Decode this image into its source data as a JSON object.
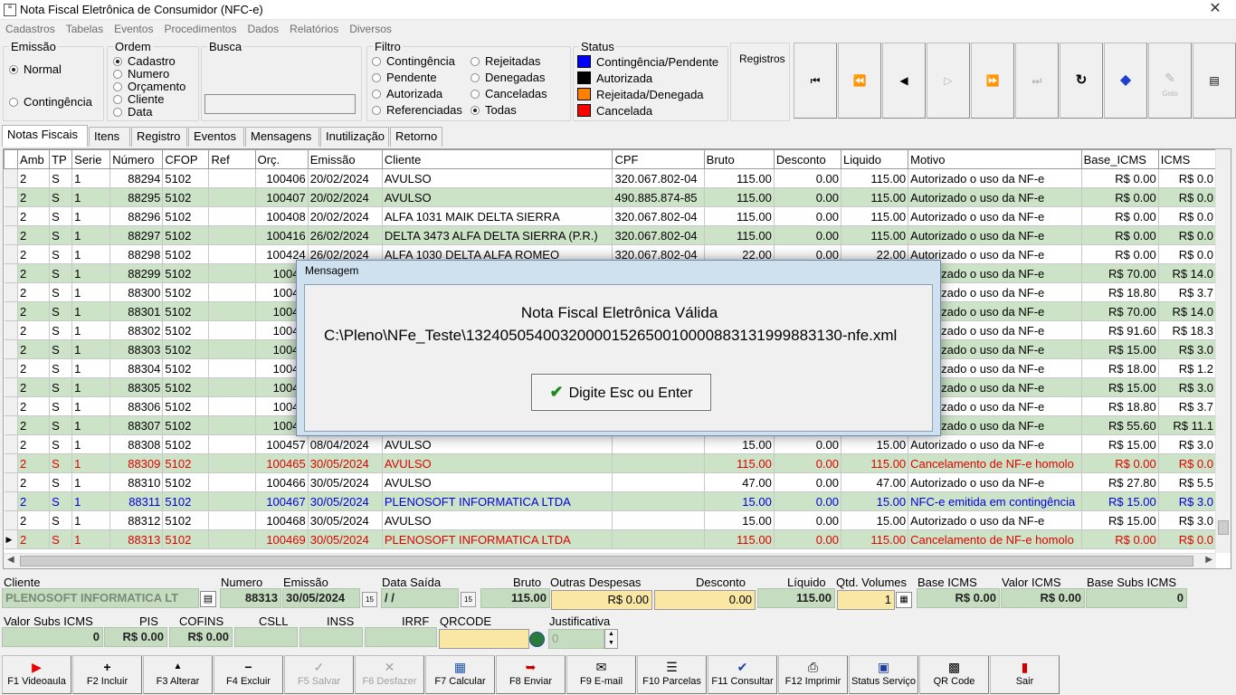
{
  "window": {
    "title": "Nota Fiscal Eletrônica de Consumidor (NFC-e)"
  },
  "menu": [
    "Cadastros",
    "Tabelas",
    "Eventos",
    "Procedimentos",
    "Dados",
    "Relatórios",
    "Diversos"
  ],
  "emissao": {
    "label": "Emissão",
    "options": [
      "Normal",
      "Contingência"
    ]
  },
  "ordem": {
    "label": "Ordem",
    "options": [
      "Cadastro",
      "Numero",
      "Orçamento",
      "Cliente",
      "Data"
    ]
  },
  "busca": {
    "label": "Busca",
    "value": ""
  },
  "filtro": {
    "label": "Filtro",
    "col1": [
      "Contingência",
      "Pendente",
      "Autorizada",
      "Referenciadas"
    ],
    "col2": [
      "Rejeitadas",
      "Denegadas",
      "Canceladas",
      "Todas"
    ]
  },
  "status": {
    "label": "Status",
    "items": [
      {
        "label": "Contingência/Pendente",
        "color": "#0000ff"
      },
      {
        "label": "Autorizada",
        "color": "#000000"
      },
      {
        "label": "Rejeitada/Denegada",
        "color": "#ff8000"
      },
      {
        "label": "Cancelada",
        "color": "#ff0000"
      }
    ]
  },
  "registros": {
    "label": "Registros"
  },
  "nav": {
    "goto": "Goto"
  },
  "tabs": [
    "Notas Fiscais",
    "Itens",
    "Registro",
    "Eventos",
    "Mensagens",
    "Inutilização",
    "Retorno"
  ],
  "grid": {
    "columns": [
      "Amb",
      "TP",
      "Serie",
      "Número",
      "CFOP",
      "Ref",
      "Orç.",
      "Emissão",
      "Cliente",
      "CPF",
      "Bruto",
      "Desconto",
      "Liquido",
      "Motivo",
      "Base_ICMS",
      "ICMS"
    ],
    "rows": [
      [
        "2",
        "S",
        "1",
        "88294",
        "5102",
        "",
        "100406",
        "20/02/2024",
        "AVULSO",
        "320.067.802-04",
        "115.00",
        "0.00",
        "115.00",
        "Autorizado o uso da NF-e",
        "R$ 0.00",
        "R$ 0.0"
      ],
      [
        "2",
        "S",
        "1",
        "88295",
        "5102",
        "",
        "100407",
        "20/02/2024",
        "AVULSO",
        "490.885.874-85",
        "115.00",
        "0.00",
        "115.00",
        "Autorizado o uso da NF-e",
        "R$ 0.00",
        "R$ 0.0"
      ],
      [
        "2",
        "S",
        "1",
        "88296",
        "5102",
        "",
        "100408",
        "20/02/2024",
        "ALFA 1031 MAIK DELTA SIERRA",
        "320.067.802-04",
        "115.00",
        "0.00",
        "115.00",
        "Autorizado o uso da NF-e",
        "R$ 0.00",
        "R$ 0.0"
      ],
      [
        "2",
        "S",
        "1",
        "88297",
        "5102",
        "",
        "100416",
        "26/02/2024",
        "DELTA 3473 ALFA DELTA SIERRA (P.R.)",
        "320.067.802-04",
        "115.00",
        "0.00",
        "115.00",
        "Autorizado o uso da NF-e",
        "R$ 0.00",
        "R$ 0.0"
      ],
      [
        "2",
        "S",
        "1",
        "88298",
        "5102",
        "",
        "100424",
        "26/02/2024",
        "ALFA 1030 DELTA ALFA ROMEO",
        "320.067.802-04",
        "22.00",
        "0.00",
        "22.00",
        "Autorizado o uso da NF-e",
        "R$ 0.00",
        "R$ 0.0"
      ],
      [
        "2",
        "S",
        "1",
        "88299",
        "5102",
        "",
        "10042",
        "",
        "",
        "",
        "",
        "",
        "",
        "Autorizado o uso da NF-e",
        "R$ 70.00",
        "R$ 14.0"
      ],
      [
        "2",
        "S",
        "1",
        "88300",
        "5102",
        "",
        "10042",
        "",
        "",
        "",
        "",
        "",
        "",
        "Autorizado o uso da NF-e",
        "R$ 18.80",
        "R$ 3.7"
      ],
      [
        "2",
        "S",
        "1",
        "88301",
        "5102",
        "",
        "10042",
        "",
        "",
        "",
        "",
        "",
        "",
        "Autorizado o uso da NF-e",
        "R$ 70.00",
        "R$ 14.0"
      ],
      [
        "2",
        "S",
        "1",
        "88302",
        "5102",
        "",
        "10043",
        "",
        "",
        "",
        "",
        "",
        "",
        "Autorizado o uso da NF-e",
        "R$ 91.60",
        "R$ 18.3"
      ],
      [
        "2",
        "S",
        "1",
        "88303",
        "5102",
        "",
        "10044",
        "",
        "",
        "",
        "",
        "",
        "",
        "Autorizado o uso da NF-e",
        "R$ 15.00",
        "R$ 3.0"
      ],
      [
        "2",
        "S",
        "1",
        "88304",
        "5102",
        "",
        "10044",
        "",
        "",
        "",
        "",
        "",
        "",
        "Autorizado o uso da NF-e",
        "R$ 18.00",
        "R$ 1.2"
      ],
      [
        "2",
        "S",
        "1",
        "88305",
        "5102",
        "",
        "10045",
        "",
        "",
        "",
        "",
        "",
        "",
        "Autorizado o uso da NF-e",
        "R$ 15.00",
        "R$ 3.0"
      ],
      [
        "2",
        "S",
        "1",
        "88306",
        "5102",
        "",
        "10045",
        "",
        "",
        "",
        "",
        "",
        "",
        "Autorizado o uso da NF-e",
        "R$ 18.80",
        "R$ 3.7"
      ],
      [
        "2",
        "S",
        "1",
        "88307",
        "5102",
        "",
        "10045",
        "",
        "",
        "",
        "",
        "",
        "",
        "Autorizado o uso da NF-e",
        "R$ 55.60",
        "R$ 11.1"
      ],
      [
        "2",
        "S",
        "1",
        "88308",
        "5102",
        "",
        "100457",
        "08/04/2024",
        "AVULSO",
        "",
        "15.00",
        "0.00",
        "15.00",
        "Autorizado o uso da NF-e",
        "R$ 15.00",
        "R$ 3.0"
      ],
      [
        "2",
        "S",
        "1",
        "88309",
        "5102",
        "",
        "100465",
        "30/05/2024",
        "AVULSO",
        "",
        "115.00",
        "0.00",
        "115.00",
        "Cancelamento de NF-e homolo",
        "R$ 0.00",
        "R$ 0.0"
      ],
      [
        "2",
        "S",
        "1",
        "88310",
        "5102",
        "",
        "100466",
        "30/05/2024",
        "AVULSO",
        "",
        "47.00",
        "0.00",
        "47.00",
        "Autorizado o uso da NF-e",
        "R$ 27.80",
        "R$ 5.5"
      ],
      [
        "2",
        "S",
        "1",
        "88311",
        "5102",
        "",
        "100467",
        "30/05/2024",
        "PLENOSOFT INFORMATICA LTDA",
        "",
        "15.00",
        "0.00",
        "15.00",
        "NFC-e emitida em contingência",
        "R$ 15.00",
        "R$ 3.0"
      ],
      [
        "2",
        "S",
        "1",
        "88312",
        "5102",
        "",
        "100468",
        "30/05/2024",
        "AVULSO",
        "",
        "15.00",
        "0.00",
        "15.00",
        "Autorizado o uso da NF-e",
        "R$ 15.00",
        "R$ 3.0"
      ],
      [
        "2",
        "S",
        "1",
        "88313",
        "5102",
        "",
        "100469",
        "30/05/2024",
        "PLENOSOFT INFORMATICA LTDA",
        "",
        "115.00",
        "0.00",
        "115.00",
        "Cancelamento de NF-e homolo",
        "R$ 0.00",
        "R$ 0.0"
      ]
    ],
    "row_status": [
      "black",
      "black",
      "black",
      "black",
      "black",
      "black",
      "black",
      "black",
      "black",
      "black",
      "black",
      "black",
      "black",
      "black",
      "black",
      "red",
      "black",
      "blue",
      "black",
      "red"
    ]
  },
  "detail": {
    "cliente": {
      "label": "Cliente",
      "value": "PLENOSOFT INFORMATICA LT"
    },
    "numero": {
      "label": "Numero",
      "value": "88313"
    },
    "emissao": {
      "label": "Emissão",
      "value": "30/05/2024"
    },
    "data_saida": {
      "label": "Data Saída",
      "value": "/  /"
    },
    "bruto": {
      "label": "Bruto",
      "value": "115.00"
    },
    "outras": {
      "label": "Outras Despesas",
      "value": "R$ 0.00"
    },
    "desconto": {
      "label": "Desconto",
      "value": "0.00"
    },
    "liquido": {
      "label": "Líquido",
      "value": "115.00"
    },
    "qtd": {
      "label": "Qtd. Volumes",
      "value": "1"
    },
    "base_icms": {
      "label": "Base ICMS",
      "value": "R$ 0.00"
    },
    "valor_icms": {
      "label": "Valor ICMS",
      "value": "R$ 0.00"
    },
    "base_subs": {
      "label": "Base Subs ICMS",
      "value": "0"
    },
    "valor_subs": {
      "label": "Valor Subs ICMS",
      "value": "0"
    },
    "pis": {
      "label": "PIS",
      "value": "R$ 0.00"
    },
    "cofins": {
      "label": "COFINS",
      "value": "R$ 0.00"
    },
    "csll": {
      "label": "CSLL",
      "value": ""
    },
    "inss": {
      "label": "INSS",
      "value": ""
    },
    "irrf": {
      "label": "IRRF",
      "value": ""
    },
    "qrcode": {
      "label": "QRCODE",
      "value": ""
    },
    "justificativa": {
      "label": "Justificativa",
      "value": "0"
    }
  },
  "footer": [
    "F1 Videoaula",
    "F2 Incluir",
    "F3 Alterar",
    "F4 Excluir",
    "F5 Salvar",
    "F6 Desfazer",
    "F7 Calcular",
    "F8 Enviar",
    "F9 E-mail",
    "F10 Parcelas",
    "F11 Consultar",
    "F12 Imprimir",
    "Status Serviço",
    "QR Code",
    "Sair"
  ],
  "dialog": {
    "title": "Mensagem",
    "line1": "Nota Fiscal Eletrônica Válida",
    "line2": "C:\\Pleno\\NFe_Teste\\13240505400320000152650010000883131999883130-nfe.xml",
    "button": "Digite Esc ou Enter"
  }
}
